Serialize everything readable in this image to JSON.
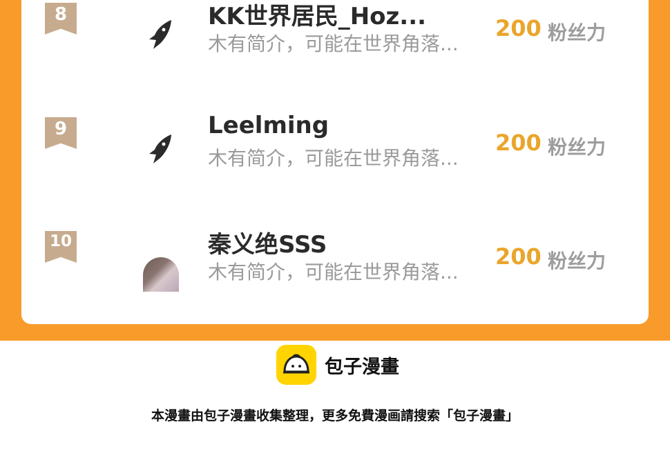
{
  "ranking": {
    "rows": [
      {
        "rank": "8",
        "name": "KK世界居民_Hoz...",
        "bio": "木有简介，可能在世界角落...",
        "score": "200",
        "score_unit": "粉丝力",
        "avatar": "fox-logo-icon"
      },
      {
        "rank": "9",
        "name": "Leelming",
        "bio": "木有简介，可能在世界角落...",
        "score": "200",
        "score_unit": "粉丝力",
        "avatar": "fox-logo-icon"
      },
      {
        "rank": "10",
        "name": "秦义绝SSS",
        "bio": "木有简介，可能在世界角落...",
        "score": "200",
        "score_unit": "粉丝力",
        "avatar": "user-photo"
      }
    ]
  },
  "footer": {
    "brand_name": "包子漫畫",
    "logo_icon": "bun-logo-icon",
    "note": "本漫畫由包子漫畫收集整理，更多免費漫画請搜索「包子漫畫」"
  },
  "colors": {
    "accent_orange": "#f99b2a",
    "score_gold": "#eaa52b",
    "badge_tan": "#c7ab8e",
    "logo_yellow": "#ffd400"
  }
}
